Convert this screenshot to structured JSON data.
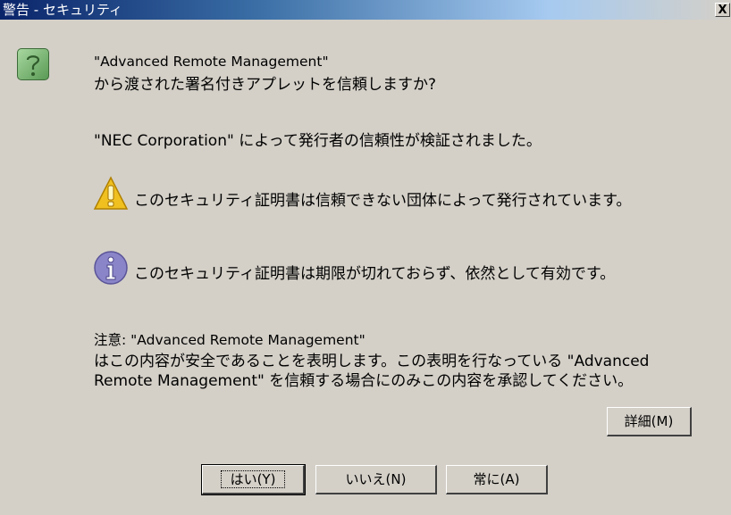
{
  "window": {
    "title": "警告 - セキュリティ",
    "close_label": "X"
  },
  "message": {
    "line1": "\"Advanced Remote Management\"",
    "line2": "から渡された署名付きアプレットを信頼しますか?",
    "verified": "\"NEC Corporation\" によって発行者の信頼性が検証されました。"
  },
  "warning": {
    "text": "このセキュリティ証明書は信頼できない団体によって発行されています。"
  },
  "info": {
    "text": "このセキュリティ証明書は期限が切れておらず、依然として有効です。"
  },
  "notice": {
    "line1": "注意: \"Advanced Remote Management\"",
    "line2": "はこの内容が安全であることを表明します。この表明を行なっている \"Advanced",
    "line3": "Remote Management\" を信頼する場合にのみこの内容を承認してください。"
  },
  "buttons": {
    "details": "詳細(M)",
    "yes": "はい(Y)",
    "no": "いいえ(N)",
    "always": "常に(A)"
  }
}
